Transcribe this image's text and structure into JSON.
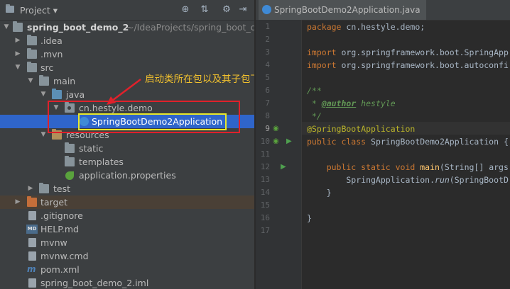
{
  "project_panel": {
    "title": "Project",
    "tree": [
      {
        "label": "spring_boot_demo_2",
        "sub": "~/IdeaProjects/spring_boot_d"
      },
      {
        "label": ".idea"
      },
      {
        "label": ".mvn"
      },
      {
        "label": "src"
      },
      {
        "label": "main"
      },
      {
        "label": "java"
      },
      {
        "label": "cn.hestyle.demo"
      },
      {
        "label": "SpringBootDemo2Application"
      },
      {
        "label": "resources"
      },
      {
        "label": "static"
      },
      {
        "label": "templates"
      },
      {
        "label": "application.properties"
      },
      {
        "label": "test"
      },
      {
        "label": "target"
      },
      {
        "label": ".gitignore"
      },
      {
        "label": "HELP.md"
      },
      {
        "label": "mvnw"
      },
      {
        "label": "mvnw.cmd"
      },
      {
        "label": "pom.xml"
      },
      {
        "label": "spring_boot_demo_2.iml"
      }
    ],
    "icons": {
      "add": "crosshair-icon",
      "collapse": "collapse-icon",
      "settings": "gear-icon",
      "hide": "hide-icon"
    },
    "mvn_glyph": "m",
    "md_glyph": "MD"
  },
  "annotation": {
    "text": "启动类所在包以及其子包下的所有包",
    "color_box": "#e0212b",
    "color_highlight": "#e8e82a",
    "color_text": "#f2c12e"
  },
  "editor": {
    "tab_label": "SpringBootDemo2Application.java",
    "line_numbers": [
      "1",
      "2",
      "3",
      "4",
      "5",
      "6",
      "7",
      "8",
      "9",
      "10",
      "11",
      "12",
      "13",
      "14",
      "15",
      "16",
      "17"
    ],
    "current_line": "9",
    "code": {
      "l1_kw": "package",
      "l1_rest": " cn.hestyle.demo;",
      "l3_kw": "import",
      "l3_rest": " org.springframework.boot.SpringApp",
      "l4_kw": "import",
      "l4_rest": " org.springframework.boot.autoconfi",
      "l6": "/**",
      "l7_star": " * ",
      "l7_tag": "@author",
      "l7_name": " hestyle",
      "l8": " */",
      "l9": "@SpringBootApplication",
      "l10_kw": "public class",
      "l10_rest": " SpringBootDemo2Application {",
      "l12_kw": "    public static void",
      "l12_fn": " main",
      "l12_rest": "(String[] args",
      "l13_a": "        SpringApplication.",
      "l13_fn": "run",
      "l13_b": "(SpringBootD",
      "l14": "    }",
      "l16": "}"
    },
    "colors": {
      "keyword": "#cc7832",
      "comment": "#629755",
      "annotation": "#bbb529",
      "function": "#ffc66d"
    }
  }
}
